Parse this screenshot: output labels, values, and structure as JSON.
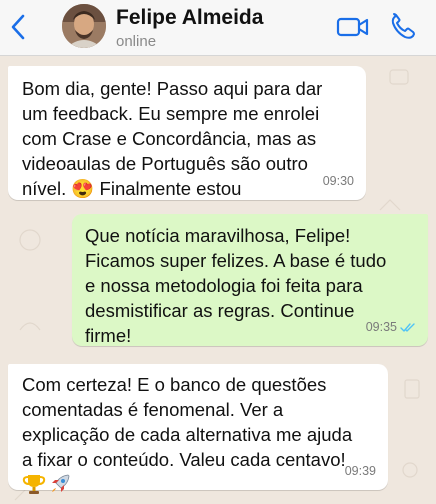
{
  "chat": {
    "contact_name": "Felipe Almeida",
    "status": "online"
  },
  "messages": [
    {
      "direction": "incoming",
      "text": "Bom dia, gente! Passo aqui para dar\num feedback. Eu sempre me enrolei\ncom Crase e Concordância, mas as\nvideoaulas de Português são outro\nnível. 😍 Finalmente estou",
      "time": "09:30"
    },
    {
      "direction": "outgoing",
      "text": "Que notícia maravilhosa, Felipe!\nFicamos super felizes. A base é tudo\ne nossa metodologia foi feita para\ndesmistificar as regras. Continue\nfirme!",
      "time": "09:35",
      "read_receipt": "double-check-icon",
      "receipt_color": "#4fc3f7"
    },
    {
      "direction": "incoming",
      "text": "Com certeza! E o banco de questões\ncomentadas é fenomenal. Ver a\nexplicação de cada alternativa me ajuda\na fixar o conteúdo. Valeu cada centavo!",
      "emojis": [
        "trophy-icon",
        "rocket-icon"
      ],
      "time": "09:39"
    }
  ],
  "colors": {
    "accent": "#1a6ee8",
    "outgoing_bubble": "#dcf8c6",
    "incoming_bubble": "#ffffff",
    "chat_background": "#efe7de"
  }
}
